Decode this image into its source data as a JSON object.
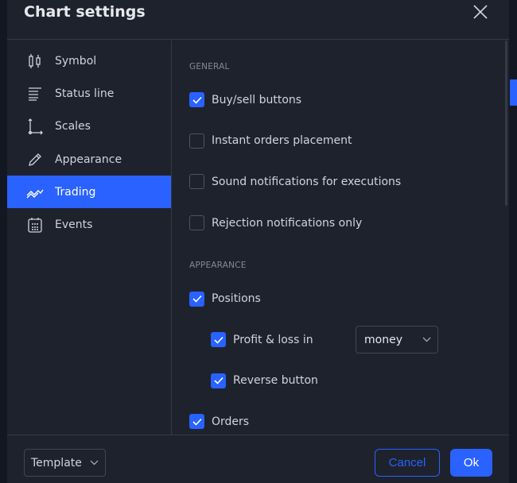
{
  "title": "Chart settings",
  "sidebar": {
    "items": [
      {
        "label": "Symbol",
        "icon": "candlestick-icon"
      },
      {
        "label": "Status line",
        "icon": "status-line-icon"
      },
      {
        "label": "Scales",
        "icon": "scales-icon"
      },
      {
        "label": "Appearance",
        "icon": "pencil-icon"
      },
      {
        "label": "Trading",
        "icon": "trading-icon",
        "active": true
      },
      {
        "label": "Events",
        "icon": "calendar-icon"
      }
    ]
  },
  "general": {
    "heading": "GENERAL",
    "options": [
      {
        "label": "Buy/sell buttons",
        "checked": true
      },
      {
        "label": "Instant orders placement",
        "checked": false
      },
      {
        "label": "Sound notifications for executions",
        "checked": false
      },
      {
        "label": "Rejection notifications only",
        "checked": false
      }
    ]
  },
  "appearance": {
    "heading": "APPEARANCE",
    "positions": {
      "label": "Positions",
      "checked": true
    },
    "pnl": {
      "label": "Profit & loss in",
      "checked": true,
      "select_value": "money"
    },
    "reverse": {
      "label": "Reverse button",
      "checked": true
    },
    "orders": {
      "label": "Orders",
      "checked": true
    }
  },
  "footer": {
    "template": "Template",
    "cancel": "Cancel",
    "ok": "Ok"
  },
  "colors": {
    "accent": "#2962ff",
    "background": "#1e222d"
  }
}
